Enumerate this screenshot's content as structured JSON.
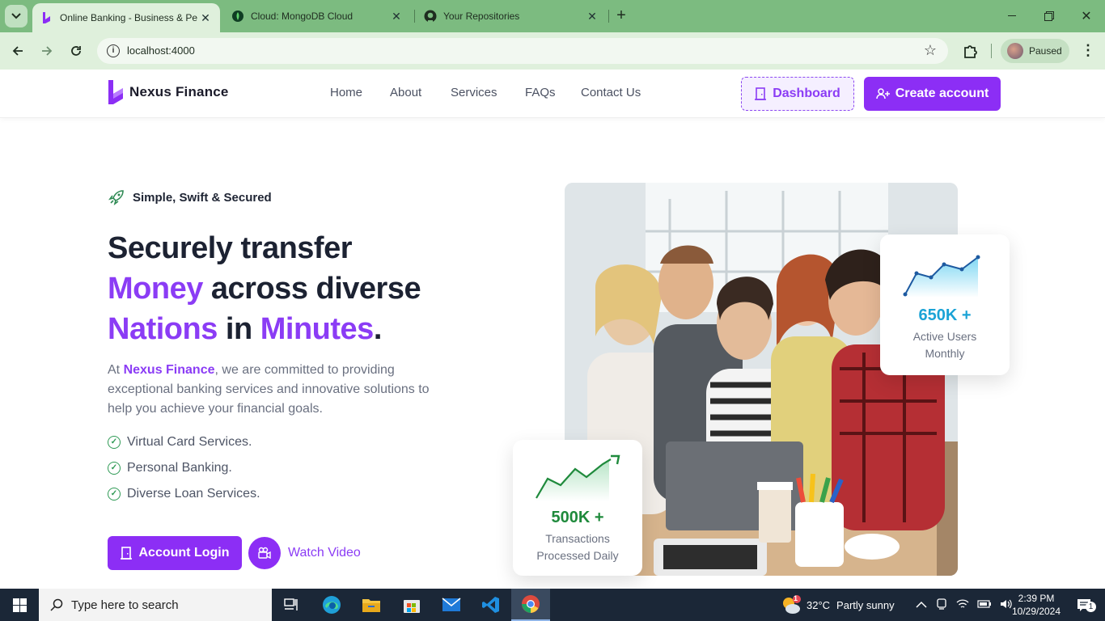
{
  "browser": {
    "tabs": [
      {
        "title": "Online Banking - Business & Pe",
        "active": true
      },
      {
        "title": "Cloud: MongoDB Cloud",
        "active": false
      },
      {
        "title": "Your Repositories",
        "active": false
      }
    ],
    "url": "localhost:4000",
    "profile_label": "Paused"
  },
  "site": {
    "brand": "Nexus Finance",
    "nav": [
      "Home",
      "About",
      "Services",
      "FAQs",
      "Contact Us"
    ],
    "dashboard_label": "Dashboard",
    "create_label": "Create account"
  },
  "hero": {
    "tagline": "Simple, Swift & Secured",
    "line1": "Securely transfer",
    "line2_hl": "Money",
    "line2_rest": " across diverse",
    "line3_hl1": "Nations",
    "line3_mid": " in ",
    "line3_hl2": "Minutes",
    "line3_end": ".",
    "desc_pre": "At ",
    "desc_brand": "Nexus Finance",
    "desc_post": ", we are committed to providing exceptional banking services and innovative solutions to help you achieve your financial goals.",
    "features": [
      "Virtual Card Services.",
      "Personal Banking.",
      "Diverse Loan Services."
    ],
    "login_label": "Account Login",
    "video_label": "Watch Video"
  },
  "stats": {
    "users_value": "650K +",
    "users_line1": "Active Users",
    "users_line2": "Monthly",
    "tx_value": "500K +",
    "tx_line1": "Transactions",
    "tx_line2": "Processed Daily"
  },
  "taskbar": {
    "search_placeholder": "Type here to search",
    "weather_temp": "32°C",
    "weather_desc": "Partly sunny",
    "time": "2:39 PM",
    "date": "10/29/2024",
    "notif_count": "1",
    "weather_badge": "1"
  },
  "colors": {
    "accent": "#8c2ef5",
    "browser_frame": "#7cbb80",
    "stat_blue": "#1ba3d6",
    "stat_green": "#1f8a3c"
  }
}
